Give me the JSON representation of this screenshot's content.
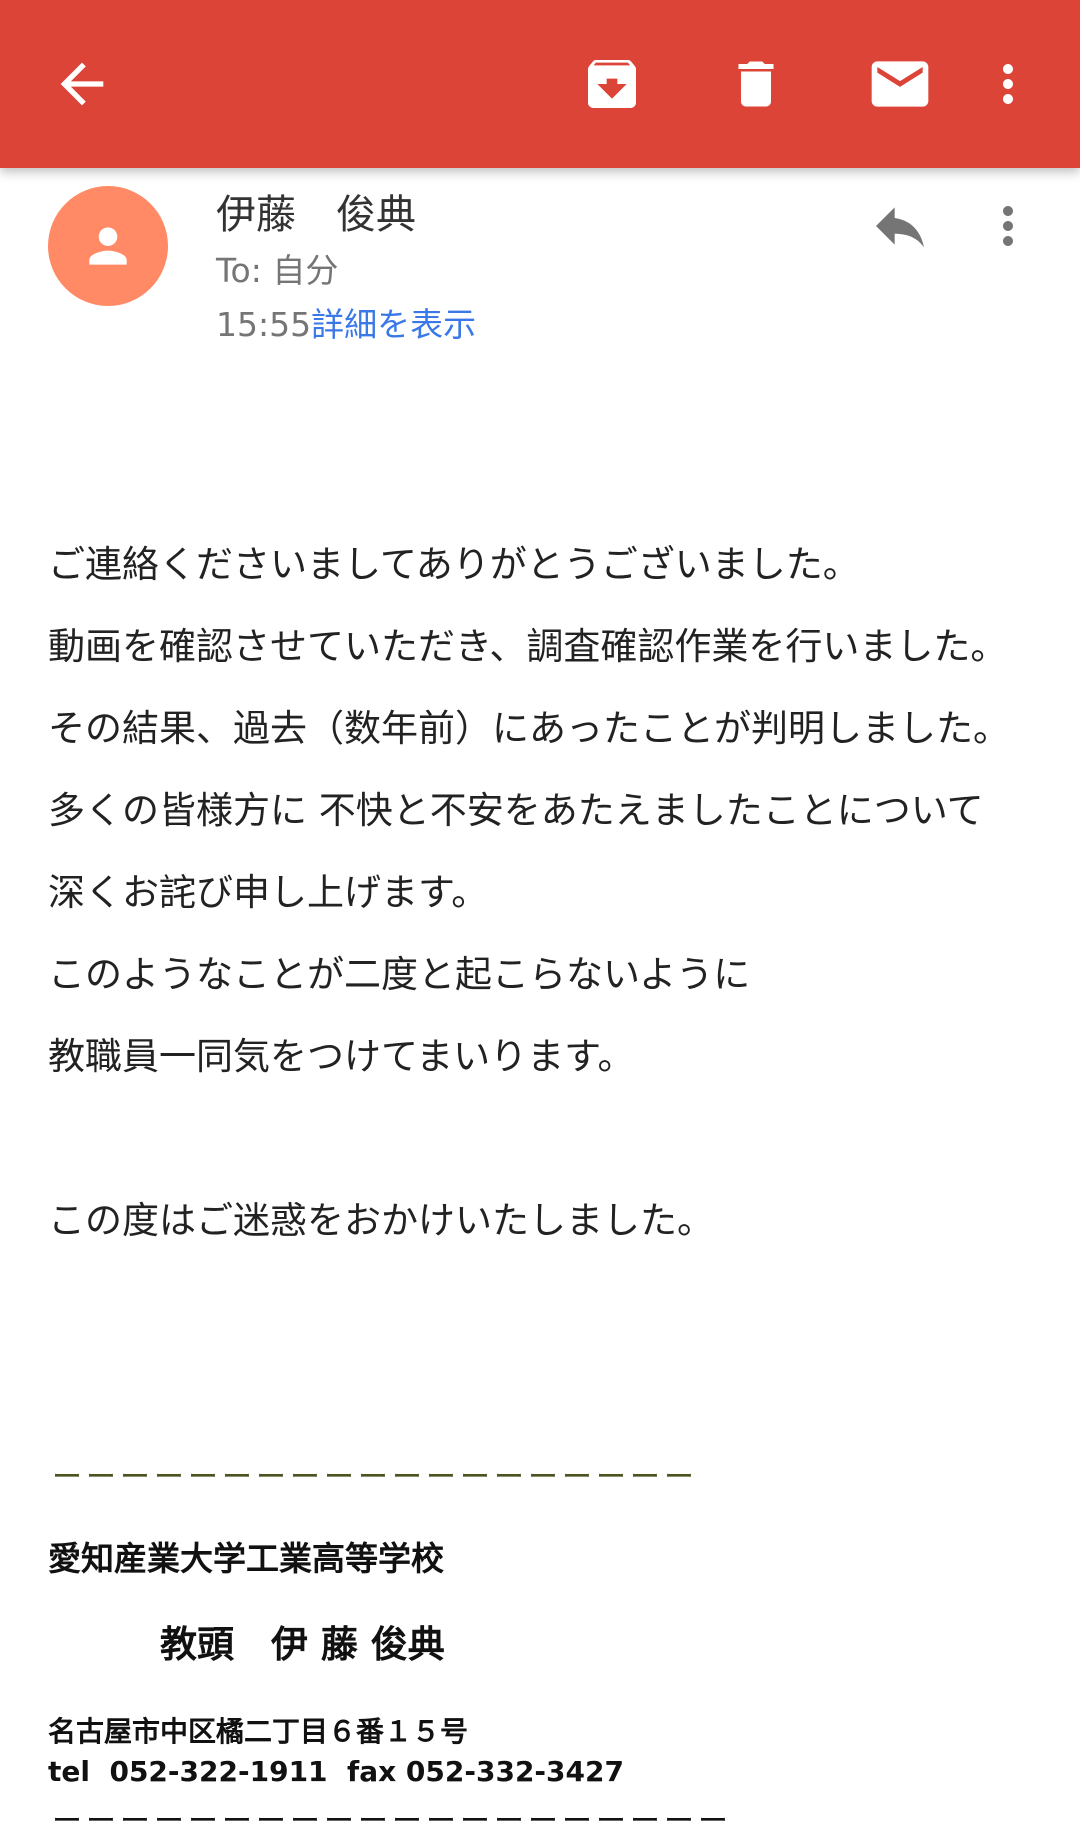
{
  "toolbar": {
    "background": "#db4437",
    "icons": [
      "arrow-back-icon",
      "archive-icon",
      "delete-icon",
      "mark-unread-icon",
      "more-vert-icon"
    ]
  },
  "message": {
    "avatar_color": "#ff8a65",
    "sender": "伊藤　俊典",
    "to": "To: 自分",
    "time": "15:55",
    "details_link": "詳細を表示",
    "link_color": "#3b78e7"
  },
  "body": {
    "lines": [
      "ご連絡くださいましてありがとうございました。",
      "動画を確認させていただき、調査確認作業を行いました。",
      "その結果、過去（数年前）にあったことが判明しました。",
      "多くの皆様方に 不快と不安をあたえましたことについて",
      "深くお詫び申し上げます。",
      "このようなことが二度と起こらないように",
      "教職員一同気をつけてまいります。",
      "この度はご迷惑をおかけいたしました。"
    ]
  },
  "signature": {
    "rule_top": "ーーーーーーーーーーーーーーーーーーー",
    "school": "愛知産業大学工業高等学校",
    "title_name": "教頭　伊 藤 俊典",
    "address": "名古屋市中区橘二丁目６番１５号",
    "phone": "tel  052-322-1911  fax 052-332-3427",
    "rule_bottom": "ーーーーーーーーーーーーーーーーーーーー"
  }
}
